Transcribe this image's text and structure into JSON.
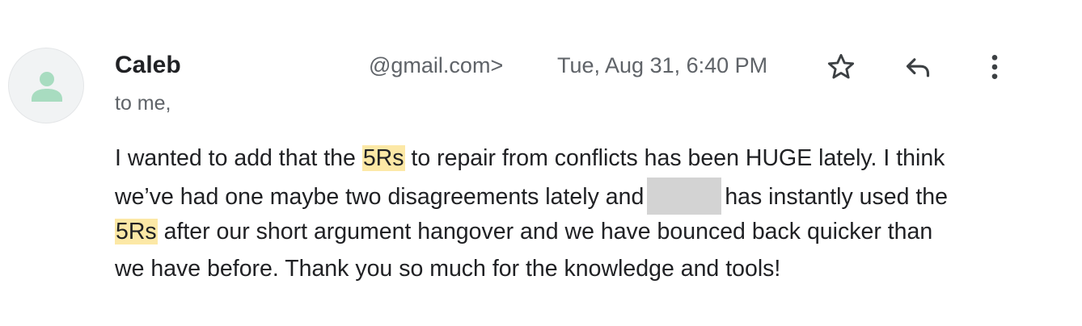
{
  "sender": {
    "name": "Caleb",
    "email": "@gmail.com>",
    "avatar_icon": "person-icon"
  },
  "date": "Tue, Aug 31, 6:40 PM",
  "recipient": "to me,",
  "actions": {
    "star_icon": "star-icon",
    "reply_icon": "reply-icon",
    "more_icon": "more-vert-icon"
  },
  "body": {
    "line1": {
      "before": "I wanted to add that the ",
      "highlight": "5Rs",
      "after": " to repair from conflicts has been HUGE lately. I think"
    },
    "line2": {
      "before": "we’ve had one maybe two disagreements lately and",
      "after": "has instantly used the"
    },
    "line3": {
      "highlight": "5Rs",
      "after": " after our short argument hangover and we have bounced back quicker than"
    },
    "line4": "we have before. Thank you so much for the knowledge and tools!"
  },
  "colors": {
    "highlight": "#fce8a6",
    "redaction": "#d3d3d3",
    "avatar_figure": "#a8dcc0",
    "avatar_bg": "#f1f3f4",
    "text": "#202124",
    "muted_text": "#5f6368"
  }
}
